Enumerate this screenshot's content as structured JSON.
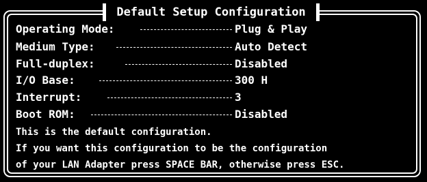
{
  "dialog": {
    "title": "Default Setup Configuration",
    "settings": [
      {
        "label": "Operating Mode:",
        "value": "Plug & Play"
      },
      {
        "label": "Medium Type:",
        "value": "Auto Detect"
      },
      {
        "label": "Full-duplex:",
        "value": "Disabled"
      },
      {
        "label": "I/O Base:",
        "value": "300 H"
      },
      {
        "label": "Interrupt:",
        "value": "3"
      },
      {
        "label": "Boot ROM:",
        "value": "Disabled"
      }
    ],
    "message_lines": [
      "This is the default configuration.",
      "If you want this configuration to be the configuration",
      "of your LAN Adapter press SPACE BAR, otherwise press ESC."
    ]
  },
  "colors": {
    "background": "#000000",
    "foreground": "#ffffff"
  }
}
